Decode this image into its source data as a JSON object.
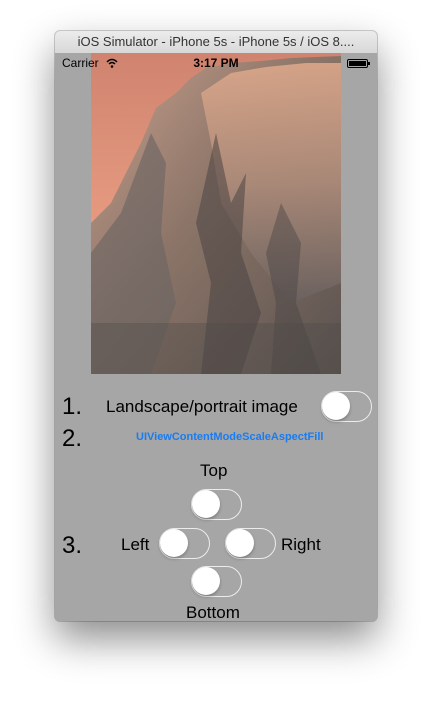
{
  "window": {
    "title": "iOS Simulator - iPhone 5s - iPhone 5s / iOS 8...."
  },
  "status_bar": {
    "carrier": "Carrier",
    "time": "3:17 PM",
    "wifi_icon": "wifi-icon",
    "battery_icon": "battery-icon"
  },
  "rows": {
    "row1": {
      "number": "1.",
      "label": "Landscape/portrait image",
      "toggle_on": false
    },
    "row2": {
      "number": "2.",
      "content_mode": "UIViewContentModeScaleAspectFill"
    },
    "row3": {
      "number": "3.",
      "top_label": "Top",
      "left_label": "Left",
      "right_label": "Right",
      "bottom_label": "Bottom",
      "top_on": false,
      "left_on": false,
      "right_on": false,
      "bottom_on": false
    }
  },
  "colors": {
    "screen_bg": "#a6a6a6",
    "link_blue": "#1a7cf0"
  }
}
